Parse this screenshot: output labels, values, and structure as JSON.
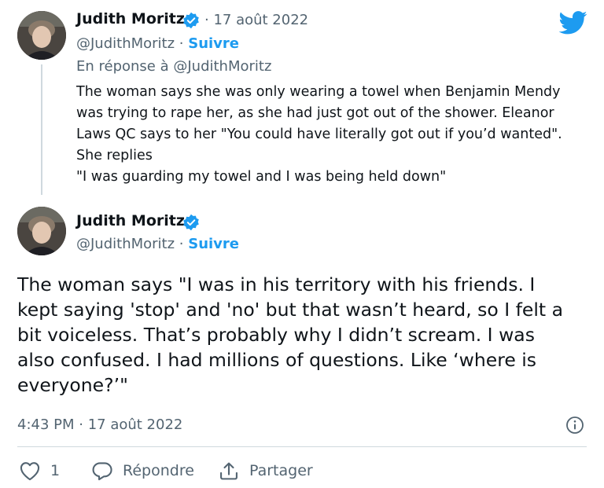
{
  "tweet1": {
    "name": "Judith Moritz",
    "date": "17 août 2022",
    "handle": "@JudithMoritz",
    "follow_label": "Suivre",
    "reply_to": "En réponse à @JudithMoritz",
    "lines": [
      "The woman says she was only wearing a towel when Benjamin Mendy",
      "was trying to rape her, as she had just got out of the shower. Eleanor",
      "Laws QC says to her \"You could have literally got out if you’d wanted\".",
      "She replies",
      "\"I was guarding my towel and I was being held down\""
    ]
  },
  "tweet2": {
    "name": "Judith Moritz",
    "handle": "@JudithMoritz",
    "follow_label": "Suivre",
    "lines": [
      "The woman says \"I was in his territory with his friends. I",
      "kept saying 'stop' and 'no' but that wasn’t heard, so I felt a",
      "bit voiceless. That’s probably why I didn’t scream. I was",
      "also confused. I had millions of questions. Like ‘where is",
      "everyone?’\""
    ],
    "timestamp": "4:43 PM · 17 août 2022"
  },
  "actions": {
    "like_count": "1",
    "reply_label": "Répondre",
    "share_label": "Partager"
  },
  "icons": {
    "brand": "twitter-bird-icon",
    "verified": "verified-badge-icon",
    "info": "info-icon",
    "like": "heart-icon",
    "reply": "speech-bubble-icon",
    "share": "share-icon"
  },
  "colors": {
    "accent": "#1d9bf0",
    "text": "#0f1419",
    "secondary": "#536471",
    "divider": "#cfd9de"
  }
}
